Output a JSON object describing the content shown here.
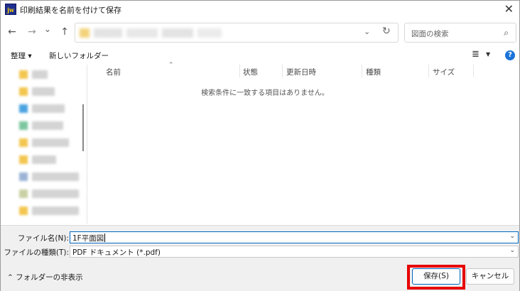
{
  "window": {
    "app_icon_label": "jw",
    "title": "印刷結果を名前を付けて保存",
    "close_glyph": "✕"
  },
  "nav": {
    "back_glyph": "←",
    "forward_glyph": "→",
    "recent_glyph": "⌄",
    "up_glyph": "↑",
    "address_dropdown_glyph": "⌄",
    "refresh_glyph": "↻",
    "search_placeholder": "図面の検索",
    "search_icon_glyph": "⌕"
  },
  "commandbar": {
    "organize_label": "整理 ▾",
    "new_folder_label": "新しいフォルダー",
    "view_glyph": "≣",
    "view_dropdown_glyph": "▼",
    "help_glyph": "?"
  },
  "colors": {
    "accent": "#0067c0",
    "highlight": "#e60000",
    "help": "#1a73d9"
  },
  "filelist": {
    "sort_glyph": "⌃",
    "columns": [
      "名前",
      "状態",
      "更新日時",
      "種類",
      "サイズ"
    ],
    "empty_message": "検索条件に一致する項目はありません。"
  },
  "form": {
    "filename_label": "ファイル名(N):",
    "filename_value": "1F平面図",
    "filetype_label": "ファイルの種類(T):",
    "filetype_value": "PDF ドキュメント (*.pdf)",
    "dropdown_glyph": "⌄"
  },
  "footer": {
    "hide_folders_label": "⌃  フォルダーの非表示",
    "save_label": "保存(S)",
    "cancel_label": "キャンセル"
  }
}
